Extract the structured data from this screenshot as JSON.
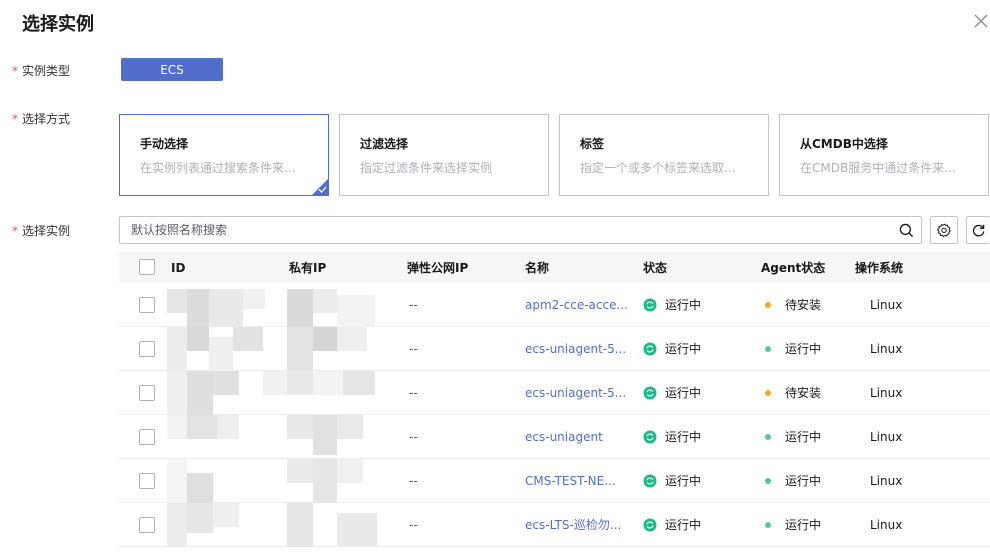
{
  "dialog": {
    "title": "选择实例",
    "close_icon": "close-icon"
  },
  "form": {
    "instance_type": {
      "label": "实例类型",
      "required": true,
      "value": "ECS"
    },
    "select_method": {
      "label": "选择方式",
      "required": true,
      "options": [
        {
          "title": "手动选择",
          "desc": "在实例列表通过搜索条件来...",
          "selected": true
        },
        {
          "title": "过滤选择",
          "desc": "指定过滤条件来选择实例",
          "selected": false
        },
        {
          "title": "标签",
          "desc": "指定一个或多个标签来选取...",
          "selected": false
        },
        {
          "title": "从CMDB中选择",
          "desc": "在CMDB服务中通过条件来...",
          "selected": false
        }
      ]
    },
    "select_instance": {
      "label": "选择实例",
      "required": true,
      "search_placeholder": "默认按照名称搜索",
      "search_value": ""
    }
  },
  "toolbar": {
    "search_icon": "search-icon",
    "settings_icon": "gear-icon",
    "refresh_icon": "refresh-icon"
  },
  "table": {
    "columns": [
      "ID",
      "私有IP",
      "弹性公网IP",
      "名称",
      "状态",
      "Agent状态",
      "操作系统"
    ],
    "rows": [
      {
        "eip": "--",
        "name": "apm2-cce-acce...",
        "status": "运行中",
        "agent_status": "待安装",
        "agent_color": "#f5a623",
        "os": "Linux"
      },
      {
        "eip": "--",
        "name": "ecs-uniagent-5...",
        "status": "运行中",
        "agent_status": "运行中",
        "agent_color": "#50c9a0",
        "os": "Linux"
      },
      {
        "eip": "--",
        "name": "ecs-uniagent-5...",
        "status": "运行中",
        "agent_status": "待安装",
        "agent_color": "#f5a623",
        "os": "Linux"
      },
      {
        "eip": "--",
        "name": "ecs-uniagent",
        "status": "运行中",
        "agent_status": "运行中",
        "agent_color": "#50c9a0",
        "os": "Linux"
      },
      {
        "eip": "--",
        "name": "CMS-TEST-NE...",
        "status": "运行中",
        "agent_status": "运行中",
        "agent_color": "#50c9a0",
        "os": "Linux"
      },
      {
        "eip": "--",
        "name": "ecs-LTS-巡检勿...",
        "status": "运行中",
        "agent_status": "运行中",
        "agent_color": "#50c9a0",
        "os": "Linux"
      }
    ]
  },
  "colors": {
    "accent": "#526ecc",
    "running": "#1db88a",
    "pending": "#f5a623"
  }
}
